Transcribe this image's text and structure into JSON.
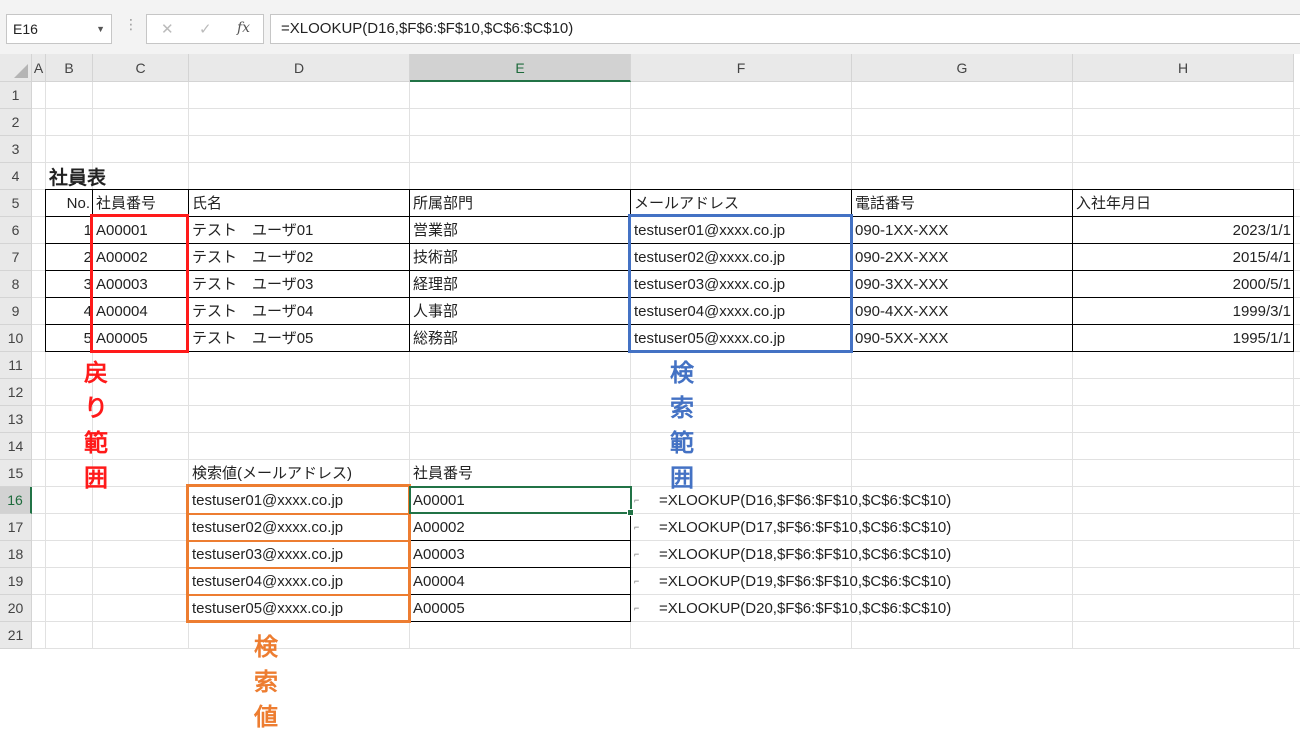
{
  "namebox": {
    "value": "E16"
  },
  "formula_bar": {
    "cancel_symbol": "✕",
    "enter_symbol": "✓",
    "fx_symbol": "fx",
    "formula": "=XLOOKUP(D16,$F$6:$F$10,$C$6:$C$10)"
  },
  "columns": [
    "A",
    "B",
    "C",
    "D",
    "E",
    "F",
    "G",
    "H"
  ],
  "rows": [
    "1",
    "2",
    "3",
    "4",
    "5",
    "6",
    "7",
    "8",
    "9",
    "10",
    "11",
    "12",
    "13",
    "14",
    "15",
    "16",
    "17",
    "18",
    "19",
    "20",
    "21"
  ],
  "sheet": {
    "title": "社員表",
    "headers": [
      "No.",
      "社員番号",
      "氏名",
      "所属部門",
      "メールアドレス",
      "電話番号",
      "入社年月日"
    ],
    "records": [
      {
        "no": "1",
        "id": "A00001",
        "name": "テスト　ユーザ01",
        "dept": "営業部",
        "email": "testuser01@xxxx.co.jp",
        "phone": "090-1XX-XXX",
        "date": "2023/1/1"
      },
      {
        "no": "2",
        "id": "A00002",
        "name": "テスト　ユーザ02",
        "dept": "技術部",
        "email": "testuser02@xxxx.co.jp",
        "phone": "090-2XX-XXX",
        "date": "2015/4/1"
      },
      {
        "no": "3",
        "id": "A00003",
        "name": "テスト　ユーザ03",
        "dept": "経理部",
        "email": "testuser03@xxxx.co.jp",
        "phone": "090-3XX-XXX",
        "date": "2000/5/1"
      },
      {
        "no": "4",
        "id": "A00004",
        "name": "テスト　ユーザ04",
        "dept": "人事部",
        "email": "testuser04@xxxx.co.jp",
        "phone": "090-4XX-XXX",
        "date": "1999/3/1"
      },
      {
        "no": "5",
        "id": "A00005",
        "name": "テスト　ユーザ05",
        "dept": "総務部",
        "email": "testuser05@xxxx.co.jp",
        "phone": "090-5XX-XXX",
        "date": "1995/1/1"
      }
    ],
    "lookup_headers": [
      "検索値(メールアドレス)",
      "社員番号"
    ],
    "lookup_rows": [
      {
        "email": "testuser01@xxxx.co.jp",
        "id": "A00001",
        "formula": "=XLOOKUP(D16,$F$6:$F$10,$C$6:$C$10)"
      },
      {
        "email": "testuser02@xxxx.co.jp",
        "id": "A00002",
        "formula": "=XLOOKUP(D17,$F$6:$F$10,$C$6:$C$10)"
      },
      {
        "email": "testuser03@xxxx.co.jp",
        "id": "A00003",
        "formula": "=XLOOKUP(D18,$F$6:$F$10,$C$6:$C$10)"
      },
      {
        "email": "testuser04@xxxx.co.jp",
        "id": "A00004",
        "formula": "=XLOOKUP(D19,$F$6:$F$10,$C$6:$C$10)"
      },
      {
        "email": "testuser05@xxxx.co.jp",
        "id": "A00005",
        "formula": "=XLOOKUP(D20,$F$6:$F$10,$C$6:$C$10)"
      }
    ]
  },
  "annotations": {
    "return_range": "戻り範囲",
    "search_range": "検索範囲",
    "search_value": "検索値"
  },
  "colors": {
    "return_range": "#ff1a1a",
    "search_range": "#4472c4",
    "search_value": "#ed7d31",
    "selection": "#217346"
  }
}
